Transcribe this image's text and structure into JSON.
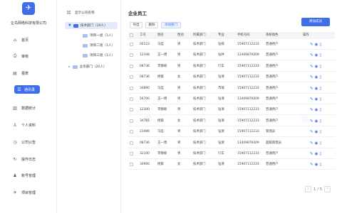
{
  "sidebar": {
    "logo_icon": "paper-plane-icon",
    "company": "企鸟网络科技有限公司",
    "items": [
      {
        "label": "首页",
        "icon": "home-icon",
        "glyph": "⌂"
      },
      {
        "label": "审核",
        "icon": "inbox-icon",
        "glyph": "⎙"
      },
      {
        "label": "报表",
        "icon": "document-icon",
        "glyph": "▤"
      },
      {
        "label": "通讯录",
        "icon": "contacts-icon",
        "glyph": "☰",
        "active": true
      },
      {
        "label": "数据统计",
        "icon": "bar-chart-icon",
        "glyph": "▥"
      },
      {
        "label": "个人资料",
        "icon": "user-icon",
        "glyph": "♙"
      },
      {
        "label": "公司公告",
        "icon": "clock-icon",
        "glyph": "◷"
      },
      {
        "label": "操作日志",
        "icon": "log-icon",
        "glyph": "↻"
      },
      {
        "label": "账号管理",
        "icon": "account-icon",
        "glyph": "♟"
      },
      {
        "label": "项目管理",
        "icon": "rocket-icon",
        "glyph": "✈"
      }
    ]
  },
  "tree": {
    "root": "显示公司名称",
    "dept": "技术部门（20人）",
    "groups": [
      "项目一组（1人）",
      "项目二组（1人）",
      "项目三组（1人）"
    ],
    "other": "业务部门（20人）"
  },
  "main": {
    "title": "企业员工",
    "add_button": "添加成员",
    "toolbar": {
      "export": "导出",
      "delete": "删除",
      "add_dept": "添加部门"
    },
    "columns": [
      "工号",
      "姓名",
      "性别",
      "所属部门",
      "专业",
      "手机号码",
      "系统角色",
      "操作"
    ],
    "rows": [
      [
        "00123",
        "马廷",
        "男",
        "技术部门",
        "钻探",
        "15907112233",
        "普通用户"
      ],
      [
        "12348",
        "王一博",
        "男",
        "技术部门",
        "钻井",
        "13409876009",
        "普通用户"
      ],
      [
        "08736",
        "李静硕",
        "男",
        "技术部门",
        "行车",
        "15907112233",
        "普通用户"
      ],
      [
        "08736",
        "杨紫",
        "女",
        "技术部门",
        "钻清",
        "15907112233",
        "普通用户"
      ],
      [
        "34890",
        "马廷",
        "男",
        "技术部门",
        "市域",
        "15907112233",
        "普通用户"
      ],
      [
        "56700",
        "王一博",
        "男",
        "技术部门",
        "钻清",
        "13409876009",
        "普通用户"
      ],
      [
        "12300",
        "李静硕",
        "男",
        "技术部门",
        "钻清",
        "15907112233",
        "普通用户"
      ],
      [
        "34781",
        "杨紫",
        "女",
        "技术部门",
        "钻清",
        "15907112233",
        "普通用户"
      ],
      [
        "23489",
        "马廷",
        "男",
        "技术部门",
        "钻清",
        "15907112233",
        "管理员"
      ],
      [
        "08736",
        "王一博",
        "男",
        "技术部门",
        "钻清",
        "13409876009",
        "超级管理员"
      ],
      [
        "32100",
        "李静硕",
        "男",
        "技术部门",
        "行车",
        "15907112233",
        "普通用户"
      ],
      [
        "34900",
        "杨紫",
        "女",
        "技术部门",
        "钻清",
        "15907112233",
        "普通用户"
      ]
    ],
    "op_icons": [
      "edit-icon",
      "view-icon",
      "trash-icon"
    ],
    "pager": {
      "current": "1",
      "separator": "/",
      "total": "5"
    }
  },
  "colors": {
    "accent": "#3f6ee8"
  }
}
